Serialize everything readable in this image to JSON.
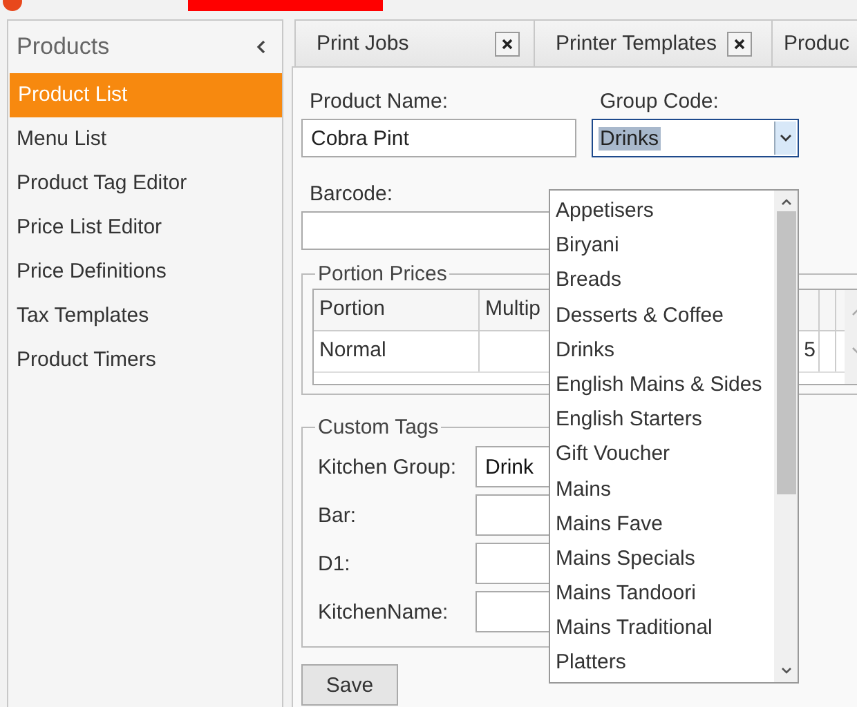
{
  "sidebar": {
    "title": "Products",
    "items": [
      {
        "label": "Product List",
        "selected": true
      },
      {
        "label": "Menu List",
        "selected": false
      },
      {
        "label": "Product Tag Editor",
        "selected": false
      },
      {
        "label": "Price List Editor",
        "selected": false
      },
      {
        "label": "Price Definitions",
        "selected": false
      },
      {
        "label": "Tax Templates",
        "selected": false
      },
      {
        "label": "Product Timers",
        "selected": false
      }
    ]
  },
  "tabs": [
    {
      "label": "Print Jobs",
      "closable": true
    },
    {
      "label": "Printer Templates",
      "closable": true
    },
    {
      "label": "Produc"
    }
  ],
  "form": {
    "product_name": {
      "label": "Product Name:",
      "value": "Cobra Pint"
    },
    "group_code": {
      "label": "Group Code:",
      "value": "Drinks",
      "expanded": true,
      "options": [
        "Appetisers",
        "Biryani",
        "Breads",
        "Desserts & Coffee",
        "Drinks",
        "English Mains & Sides",
        "English Starters",
        "Gift Voucher",
        "Mains",
        "Mains Fave",
        "Mains Specials",
        "Mains Tandoori",
        "Mains Traditional",
        "Platters"
      ]
    },
    "barcode": {
      "label": "Barcode:"
    }
  },
  "portion_prices": {
    "title": "Portion Prices",
    "columns": [
      "Portion",
      "Multip"
    ],
    "rows": [
      {
        "portion": "Normal",
        "column_3": "5"
      }
    ]
  },
  "custom_tags": {
    "title": "Custom Tags",
    "rows": [
      {
        "label": "Kitchen Group:",
        "value": "Drink"
      },
      {
        "label": "Bar:"
      },
      {
        "label": "D1:"
      },
      {
        "label": "KitchenName:"
      }
    ]
  },
  "save_button": "Save"
}
